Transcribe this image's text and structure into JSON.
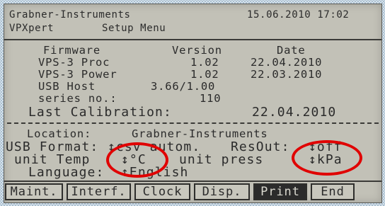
{
  "header": {
    "company": "Grabner-Instruments",
    "datetime": "15.06.2010 17:02",
    "product": "VPXpert",
    "menu_title": "Setup Menu"
  },
  "firmware_table": {
    "headers": {
      "firmware": "Firmware",
      "version": "Version",
      "date": "Date"
    },
    "rows": [
      {
        "name": "VPS-3 Proc",
        "version": "1.02",
        "date": "22.04.2010"
      },
      {
        "name": "VPS-3 Power",
        "version": "1.02",
        "date": "22.03.2010"
      },
      {
        "name": "USB Host",
        "version": "3.66/1.00",
        "date": ""
      },
      {
        "name": "series no.:",
        "version": "110",
        "date": ""
      }
    ],
    "last_calibration": {
      "label": "Last Calibration:",
      "date": "22.04.2010"
    }
  },
  "settings": {
    "location": {
      "label": "Location:",
      "value": "Grabner-Instruments"
    },
    "usb_format": {
      "label": "USB Format:",
      "value": "↕csv autom.",
      "resout_label": "ResOut:",
      "resout_value": "↕off"
    },
    "unit_temp": {
      "label": "unit Temp",
      "value": "↕°C"
    },
    "unit_press": {
      "label": "unit press",
      "value": "↕kPa"
    },
    "language": {
      "label": "Language:",
      "value": "↕English"
    }
  },
  "function_bar": [
    {
      "label": "Maint.",
      "active": false
    },
    {
      "label": "Interf.",
      "active": false
    },
    {
      "label": "Clock",
      "active": false
    },
    {
      "label": "Disp.",
      "active": false
    },
    {
      "label": "Print",
      "active": true
    },
    {
      "label": "End",
      "active": false
    }
  ],
  "annotation": {
    "ring_color": "#e00000"
  },
  "colors": {
    "lcd_background": "#c2c1b7",
    "lcd_text": "#2b2b2b",
    "page_background": "#d7e3ec"
  }
}
